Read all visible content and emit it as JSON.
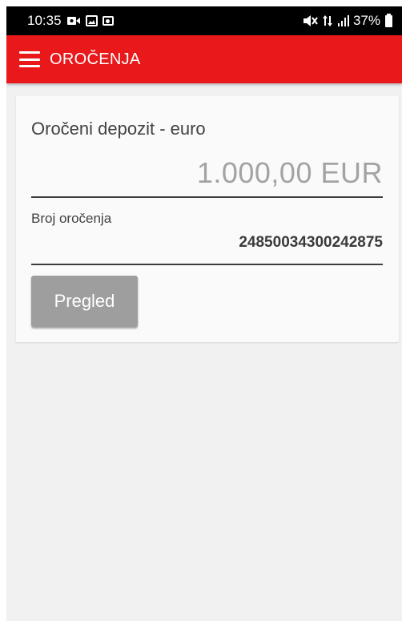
{
  "status_bar": {
    "time": "10:35",
    "battery": "37%",
    "left_icons": [
      "video-call-icon",
      "image-icon",
      "record-icon"
    ],
    "right_icons": [
      "mute-icon",
      "data-arrows-icon",
      "signal-icon",
      "battery-icon"
    ]
  },
  "app_bar": {
    "title": "OROČENJA",
    "menu_icon": "hamburger-menu-icon",
    "background": "#e8181b"
  },
  "deposit": {
    "name": "Oročeni depozit - euro",
    "amount": "1.000,00 EUR",
    "number_label": "Broj oročenja",
    "number_value": "24850034300242875",
    "view_button": "Pregled"
  },
  "colors": {
    "accent": "#e8181b",
    "button": "#9e9e9e",
    "background": "#f1f1f1"
  }
}
